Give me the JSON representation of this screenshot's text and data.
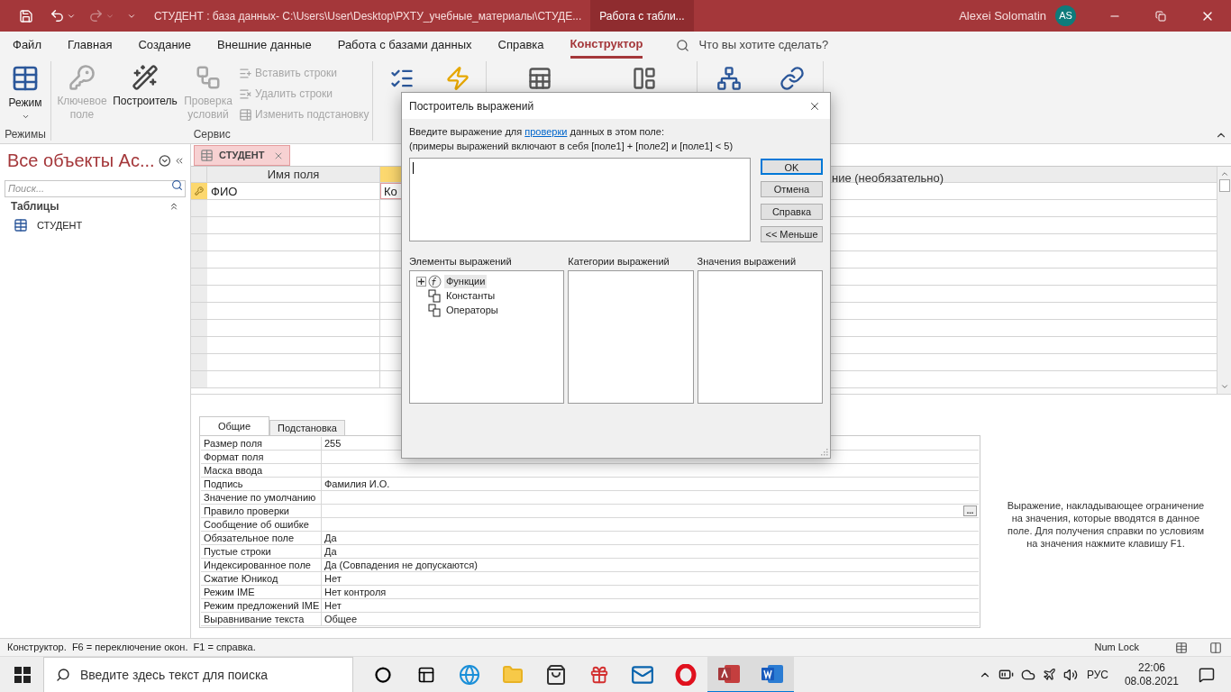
{
  "title_bar": {
    "title": "СТУДЕНТ : база данных- C:\\Users\\User\\Desktop\\РХТУ_учебные_материалы\\СТУДЕ...",
    "context_tab": "Работа с табли...",
    "user": "Alexei Solomatin",
    "avatar": "AS"
  },
  "menu_tabs": [
    {
      "label": "Файл",
      "selected": false
    },
    {
      "label": "Главная",
      "selected": false
    },
    {
      "label": "Создание",
      "selected": false
    },
    {
      "label": "Внешние данные",
      "selected": false
    },
    {
      "label": "Работа с базами данных",
      "selected": false
    },
    {
      "label": "Справка",
      "selected": false
    },
    {
      "label": "Конструктор",
      "selected": true
    }
  ],
  "tell_me": "Что вы хотите сделать?",
  "ribbon": {
    "groups": [
      {
        "label": "Режимы",
        "large": [
          {
            "label": "Режим",
            "kind": "dropdown",
            "disabled": false
          }
        ]
      },
      {
        "label": "Сервис",
        "large": [
          {
            "label": "Ключевое поле",
            "kind": "key",
            "disabled": true
          },
          {
            "label": "Построитель",
            "kind": "builder",
            "disabled": false
          },
          {
            "label": "Проверка условий",
            "kind": "check",
            "disabled": true
          }
        ],
        "small": [
          {
            "label": "Вставить строки",
            "kind": "insert",
            "disabled": true
          },
          {
            "label": "Удалить строки",
            "kind": "delete",
            "disabled": true
          },
          {
            "label": "Изменить подстановку",
            "kind": "lookup",
            "disabled": true
          }
        ]
      }
    ]
  },
  "nav": {
    "title": "Все объекты Ac...",
    "search_placeholder": "Поиск...",
    "group": "Таблицы",
    "items": [
      {
        "label": "СТУДЕНТ",
        "selected": false
      }
    ]
  },
  "doc_tab": {
    "label": "СТУДЕНТ",
    "selected": true
  },
  "grid": {
    "columns": [
      "Имя поля",
      "ние (необязательно)"
    ],
    "rows": [
      {
        "field_name": "ФИО",
        "data_type": "Ко",
        "primary_key": true,
        "selected": true
      }
    ]
  },
  "properties": {
    "tabs": [
      {
        "label": "Общие",
        "selected": true
      },
      {
        "label": "Подстановка",
        "selected": false
      }
    ],
    "rows": [
      {
        "label": "Размер поля",
        "value": "255"
      },
      {
        "label": "Формат поля",
        "value": ""
      },
      {
        "label": "Маска ввода",
        "value": ""
      },
      {
        "label": "Подпись",
        "value": "Фамилия И.О."
      },
      {
        "label": "Значение по умолчанию",
        "value": ""
      },
      {
        "label": "Правило проверки",
        "value": "",
        "button": "..."
      },
      {
        "label": "Сообщение об ошибке",
        "value": ""
      },
      {
        "label": "Обязательное поле",
        "value": "Да"
      },
      {
        "label": "Пустые строки",
        "value": "Да"
      },
      {
        "label": "Индексированное поле",
        "value": "Да (Совпадения не допускаются)"
      },
      {
        "label": "Сжатие Юникод",
        "value": "Нет"
      },
      {
        "label": "Режим IME",
        "value": "Нет контроля"
      },
      {
        "label": "Режим предложений IME",
        "value": "Нет"
      },
      {
        "label": "Выравнивание текста",
        "value": "Общее"
      }
    ],
    "help": "Выражение, накладывающее ограничение на значения, которые вводятся в данное поле. Для получения справки по условиям на значения нажмите клавишу F1."
  },
  "status_bar": {
    "text": "Конструктор.  F6 = переключение окон.  F1 = справка.",
    "num_lock": "Num Lock"
  },
  "dialog": {
    "title": "Построитель выражений",
    "prompt_before": "Введите выражение для",
    "prompt_link": "проверки",
    "prompt_after": "данных в этом поле:",
    "example": "(примеры выражений включают в себя [поле1] + [поле2] и [поле1] < 5)",
    "buttons": [
      {
        "label": "OK",
        "default": true
      },
      {
        "label": "Отмена",
        "default": false
      },
      {
        "label": "Справка",
        "default": false
      },
      {
        "label": "<< Меньше",
        "default": false
      }
    ],
    "panes": [
      "Элементы выражений",
      "Категории выражений",
      "Значения выражений"
    ],
    "tree": [
      {
        "label": "Функции",
        "kind": "functions",
        "expanded": false,
        "selected": true
      },
      {
        "label": "Константы",
        "kind": "folder",
        "selected": false
      },
      {
        "label": "Операторы",
        "kind": "folder",
        "selected": false
      }
    ]
  },
  "taskbar": {
    "search_placeholder": "Введите здесь текст для поиска",
    "apps": [
      {
        "kind": "cortana",
        "active": false
      },
      {
        "kind": "taskview",
        "active": false
      },
      {
        "kind": "edge",
        "active": false
      },
      {
        "kind": "explorer",
        "active": false
      },
      {
        "kind": "store",
        "active": false
      },
      {
        "kind": "gift",
        "active": false
      },
      {
        "kind": "mail",
        "active": false
      },
      {
        "kind": "opera",
        "active": false
      },
      {
        "kind": "access",
        "active": true
      },
      {
        "kind": "word",
        "active": true
      }
    ],
    "language": "РУС",
    "time": "22:06",
    "date": "08.08.2021"
  }
}
